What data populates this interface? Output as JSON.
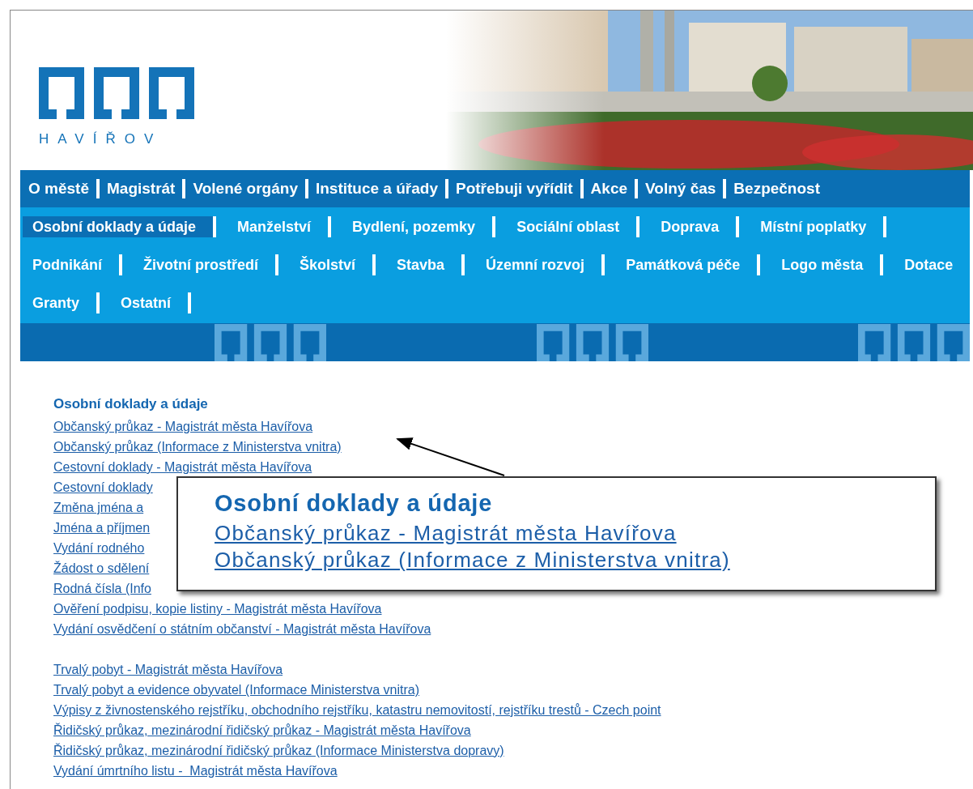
{
  "header": {
    "logo_text": "HAVÍŘOV"
  },
  "main_menu": [
    {
      "label": "O městě"
    },
    {
      "label": "Magistrát"
    },
    {
      "label": "Volené orgány"
    },
    {
      "label": "Instituce a úřady"
    },
    {
      "label": "Potřebuji vyřídit"
    },
    {
      "label": "Akce"
    },
    {
      "label": "Volný čas"
    },
    {
      "label": "Bezpečnost"
    }
  ],
  "sub_menu_rows": [
    [
      {
        "label": "Osobní doklady a údaje",
        "selected": true
      },
      {
        "label": "Manželství",
        "selected": false
      },
      {
        "label": "Bydlení, pozemky",
        "selected": false
      },
      {
        "label": "Sociální oblast",
        "selected": false
      },
      {
        "label": "Doprava",
        "selected": false
      },
      {
        "label": "Místní poplatky",
        "selected": false
      }
    ],
    [
      {
        "label": "Podnikání",
        "selected": false
      },
      {
        "label": "Životní prostředí",
        "selected": false
      },
      {
        "label": "Školství",
        "selected": false
      },
      {
        "label": "Stavba",
        "selected": false
      },
      {
        "label": "Územní rozvoj",
        "selected": false
      },
      {
        "label": "Památková péče",
        "selected": false
      },
      {
        "label": "Logo města",
        "selected": false
      },
      {
        "label": "Dotace",
        "selected": false
      }
    ],
    [
      {
        "label": "Granty",
        "selected": false
      },
      {
        "label": "Ostatní",
        "selected": false
      }
    ]
  ],
  "content": {
    "heading": "Osobní doklady a údaje",
    "link_groups": [
      [
        "Občanský průkaz - Magistrát města Havířova",
        "Občanský průkaz (Informace z Ministerstva vnitra)",
        "Cestovní doklady - Magistrát města Havířova",
        "Cestovní doklady",
        "Změna jména a",
        "Jména a příjmen",
        "Vydání rodného",
        "Žádost o sdělení",
        "Rodná čísla (Info",
        "Ověření podpisu, kopie listiny - Magistrát města Havířova",
        "Vydání osvědčení o státním občanství - Magistrát města Havířova"
      ],
      [
        "Trvalý pobyt - Magistrát města Havířova",
        "Trvalý pobyt a evidence obyvatel (Informace Ministerstva vnitra)",
        "Výpisy z živnostenského rejstříku, obchodního rejstříku, katastru nemovitostí, rejstříku trestů - Czech point",
        "Řidičský průkaz, mezinárodní řidičský průkaz - Magistrát města Havířova",
        "Řidičský průkaz, mezinárodní řidičský průkaz (Informace Ministerstva dopravy)",
        "Vydání úmrtního listu -  Magistrát města Havířova"
      ]
    ]
  },
  "callout": {
    "heading": "Osobní doklady a údaje",
    "links": [
      "Občanský průkaz - Magistrát města Havířova",
      "Občanský průkaz (Informace z Ministerstva vnitra)"
    ]
  }
}
